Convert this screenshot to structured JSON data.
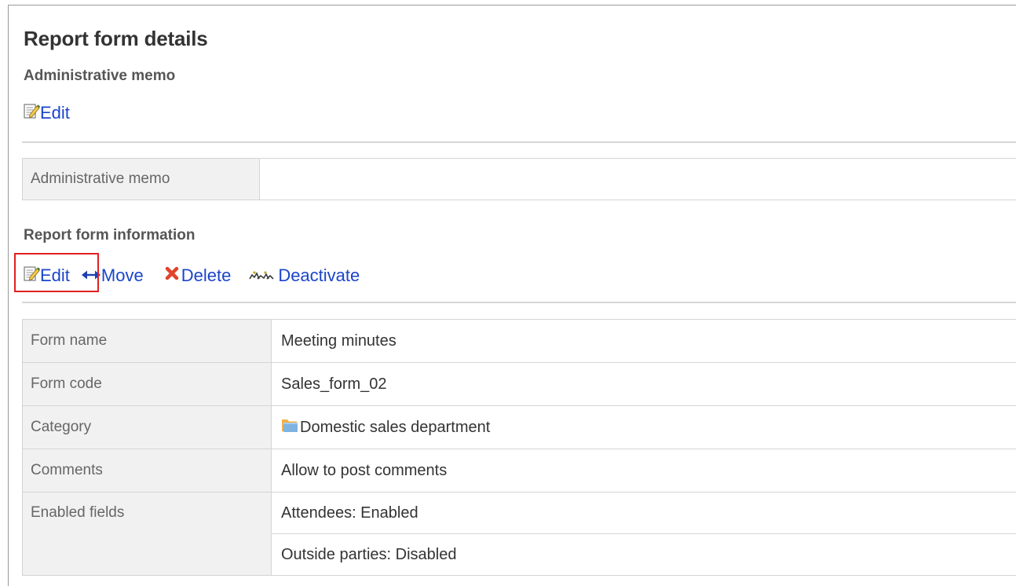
{
  "page": {
    "title": "Report form details"
  },
  "memo_section": {
    "title": "Administrative memo",
    "edit_label": "Edit",
    "table": {
      "label": "Administrative memo",
      "value": ""
    }
  },
  "info_section": {
    "title": "Report form information",
    "actions": {
      "edit": "Edit",
      "move": "Move",
      "delete": "Delete",
      "deactivate": "Deactivate"
    },
    "rows": [
      {
        "label": "Form name",
        "value": "Meeting minutes"
      },
      {
        "label": "Form code",
        "value": "Sales_form_02"
      },
      {
        "label": "Category",
        "value": "Domestic sales department",
        "icon": "folder-icon"
      },
      {
        "label": "Comments",
        "value": "Allow to post comments"
      },
      {
        "label": "Enabled fields",
        "values": [
          "Attendees: Enabled",
          "Outside parties: Disabled"
        ]
      }
    ]
  },
  "colors": {
    "link": "#1a44cc",
    "highlight": "#e02020",
    "label_bg": "#f1f1f1",
    "border": "#d4d4d4"
  }
}
